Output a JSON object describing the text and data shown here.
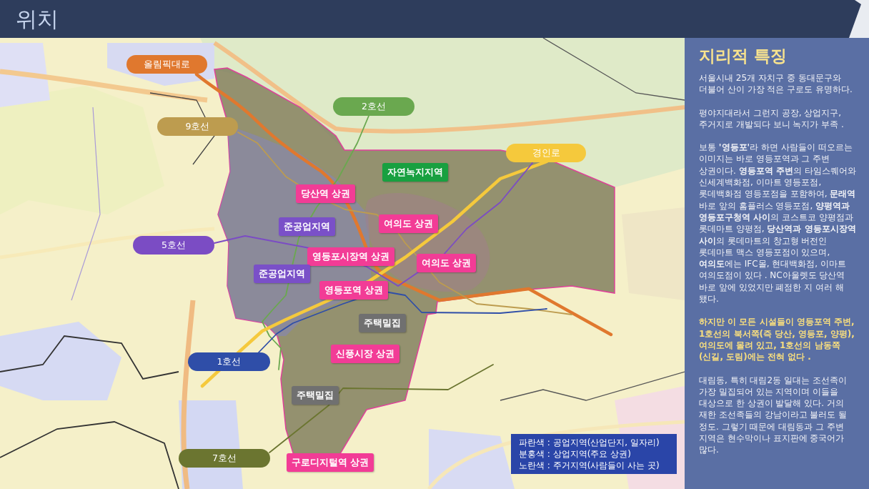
{
  "header": {
    "title": "위치"
  },
  "map": {
    "lines": [
      {
        "label": "올림픽대로",
        "color": "#e0782e",
        "kind": "road"
      },
      {
        "label": "2호선",
        "color": "#6aa84f",
        "kind": "subway"
      },
      {
        "label": "9호선",
        "color": "#bd9c4f",
        "kind": "subway"
      },
      {
        "label": "경인로",
        "color": "#f5c93c",
        "kind": "road"
      },
      {
        "label": "5호선",
        "color": "#7b4cc4",
        "kind": "subway"
      },
      {
        "label": "1호선",
        "color": "#2f4ea8",
        "kind": "subway"
      },
      {
        "label": "7호선",
        "color": "#6b7530",
        "kind": "subway"
      }
    ],
    "areas": [
      {
        "label": "자연녹지지역",
        "color": "#18a040"
      },
      {
        "label": "당산역 상권",
        "color": "#f23c96"
      },
      {
        "label": "여의도 상권",
        "color": "#f23c96"
      },
      {
        "label": "준공업지역",
        "color": "#7a50c8"
      },
      {
        "label": "영등포시장역 상권",
        "color": "#f23c96"
      },
      {
        "label": "여의도 상권",
        "color": "#f23c96"
      },
      {
        "label": "준공업지역",
        "color": "#7a50c8"
      },
      {
        "label": "영등포역 상권",
        "color": "#f23c96"
      },
      {
        "label": "주택밀집",
        "color": "#707070"
      },
      {
        "label": "신풍시장 상권",
        "color": "#f23c96"
      },
      {
        "label": "주택밀집",
        "color": "#707070"
      },
      {
        "label": "구로디지털역 상권",
        "color": "#f23c96"
      }
    ],
    "legend": [
      "파란색 : 공업지역(산업단지, 일자리)",
      "분홍색 : 상업지역(주요 상권)",
      "노란색 : 주거지역(사람들이 사는 곳)"
    ]
  },
  "panel": {
    "title": "지리적 특징",
    "paragraphs": [
      {
        "kind": "normal",
        "text": "서울시내 25개 자치구 중 동대문구와 더불어 산이 가장 적은 구로도 유명하다."
      },
      {
        "kind": "normal",
        "text": "평야지대라서 그런지 공장, 상업지구, 주거지로 개발되다 보니 녹지가 부족 ."
      },
      {
        "kind": "normal",
        "text": "보통 **'영등포'**라 하면 사람들이 떠오르는 이미지는 바로 영등포역과 그 주변 상권이다. **영등포역 주변**의 타임스퀘어와 신세계백화점, 이마트 영등포점, 롯데백화점 영등포점을 포함하여, **문래역** 바로 앞의 홈플러스 영등포점, **양평역과 영등포구청역 사이**의 코스트코 양평점과 롯데마트 양평점, **당산역과 영등포시장역 사이**의 롯데마트의 창고형 버전인 롯데마트 맥스 영등포점이 있으며, **여의도**에는 IFC몰, 현대백화점, 이마트 여의도점이 있다 . NC아울렛도 당산역 바로 앞에 있었지만 폐점한 지 여러 해 됐다."
      },
      {
        "kind": "emphasis",
        "text": "하지만 이 모든 시설들이 영등포역 주변, 1호선의 북서쪽(즉 당산, 영등포, 양평), 여의도에 몰려 있고, 1호선의 남동쪽(신길, 도림)에는 전혀 없다 ."
      },
      {
        "kind": "normal",
        "text": "대림동, 특히 대림2동 일대는 조선족이 가장 밀집되어 있는 지역이며 이들을 대상으로 한 상권이 발달해 있다. 거의 재한 조선족들의 강남이라고 불러도 될 정도. 그렇기 때문에 대림동과 그 주변 지역은 현수막이나 표지판에 중국어가 많다."
      }
    ]
  }
}
